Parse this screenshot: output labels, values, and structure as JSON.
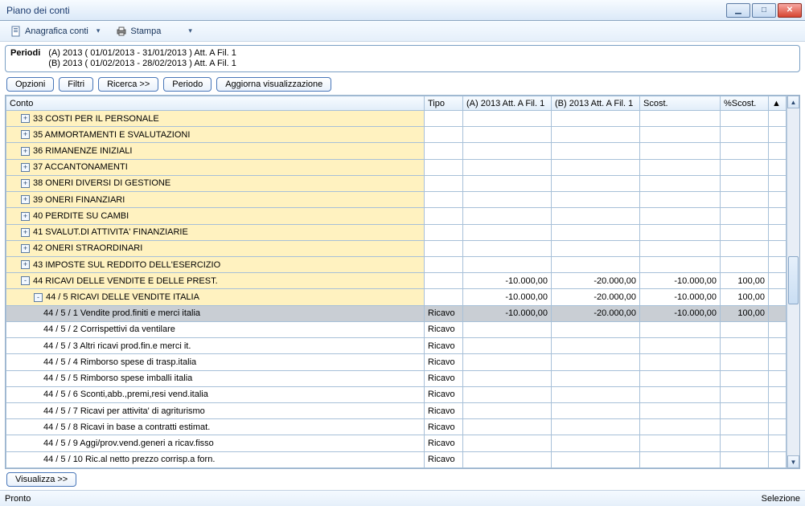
{
  "window": {
    "title": "Piano dei conti"
  },
  "toolbar": {
    "anagrafica": "Anagrafica conti",
    "stampa": "Stampa"
  },
  "period": {
    "label": "Periodi",
    "lineA": "(A) 2013 ( 01/01/2013 - 31/01/2013 )  Att. A Fil. 1",
    "lineB": "(B) 2013 ( 01/02/2013 - 28/02/2013 )  Att. A Fil. 1"
  },
  "buttons": {
    "opzioni": "Opzioni",
    "filtri": "Filtri",
    "ricerca": "Ricerca >>",
    "periodo": "Periodo",
    "aggiorna": "Aggiorna visualizzazione",
    "visualizza": "Visualizza >>"
  },
  "grid": {
    "headers": {
      "conto": "Conto",
      "tipo": "Tipo",
      "a": "(A) 2013 Att. A Fil. 1",
      "b": "(B) 2013 Att. A Fil. 1",
      "scost": "Scost.",
      "pscost": "%Scost."
    },
    "rows": [
      {
        "kind": "cat",
        "exp": "+",
        "indent": 0,
        "conto": "33 COSTI PER IL PERSONALE"
      },
      {
        "kind": "cat",
        "exp": "+",
        "indent": 0,
        "conto": "35 AMMORTAMENTI E SVALUTAZIONI"
      },
      {
        "kind": "cat",
        "exp": "+",
        "indent": 0,
        "conto": "36 RIMANENZE INIZIALI"
      },
      {
        "kind": "cat",
        "exp": "+",
        "indent": 0,
        "conto": "37 ACCANTONAMENTI"
      },
      {
        "kind": "cat",
        "exp": "+",
        "indent": 0,
        "conto": "38 ONERI DIVERSI DI GESTIONE"
      },
      {
        "kind": "cat",
        "exp": "+",
        "indent": 0,
        "conto": "39 ONERI FINANZIARI"
      },
      {
        "kind": "cat",
        "exp": "+",
        "indent": 0,
        "conto": "40 PERDITE SU CAMBI"
      },
      {
        "kind": "cat",
        "exp": "+",
        "indent": 0,
        "conto": "41 SVALUT.DI ATTIVITA' FINANZIARIE"
      },
      {
        "kind": "cat",
        "exp": "+",
        "indent": 0,
        "conto": "42 ONERI STRAORDINARI"
      },
      {
        "kind": "cat",
        "exp": "+",
        "indent": 0,
        "conto": "43 IMPOSTE SUL REDDITO DELL'ESERCIZIO"
      },
      {
        "kind": "cat",
        "exp": "-",
        "indent": 0,
        "conto": "44 RICAVI DELLE VENDITE E DELLE PREST.",
        "a": "-10.000,00",
        "b": "-20.000,00",
        "sc": "-10.000,00",
        "pc": "100,00"
      },
      {
        "kind": "cat",
        "exp": "-",
        "indent": 1,
        "conto": "44 / 5 RICAVI DELLE VENDITE ITALIA",
        "a": "-10.000,00",
        "b": "-20.000,00",
        "sc": "-10.000,00",
        "pc": "100,00"
      },
      {
        "kind": "sel",
        "indent": 2,
        "conto": "44 / 5 / 1 Vendite prod.finiti e merci italia",
        "tipo": "Ricavo",
        "a": "-10.000,00",
        "b": "-20.000,00",
        "sc": "-10.000,00",
        "pc": "100,00"
      },
      {
        "kind": "det",
        "indent": 2,
        "conto": "44 / 5 / 2 Corrispettivi da ventilare",
        "tipo": "Ricavo"
      },
      {
        "kind": "det",
        "indent": 2,
        "conto": "44 / 5 / 3 Altri ricavi prod.fin.e merci it.",
        "tipo": "Ricavo"
      },
      {
        "kind": "det",
        "indent": 2,
        "conto": "44 / 5 / 4 Rimborso spese di trasp.italia",
        "tipo": "Ricavo"
      },
      {
        "kind": "det",
        "indent": 2,
        "conto": "44 / 5 / 5 Rimborso spese imballi italia",
        "tipo": "Ricavo"
      },
      {
        "kind": "det",
        "indent": 2,
        "conto": "44 / 5 / 6 Sconti,abb.,premi,resi vend.italia",
        "tipo": "Ricavo"
      },
      {
        "kind": "det",
        "indent": 2,
        "conto": "44 / 5 / 7 Ricavi per attivita' di agriturismo",
        "tipo": "Ricavo"
      },
      {
        "kind": "det",
        "indent": 2,
        "conto": "44 / 5 / 8 Ricavi in base a contratti estimat.",
        "tipo": "Ricavo"
      },
      {
        "kind": "det",
        "indent": 2,
        "conto": "44 / 5 / 9 Aggi/prov.vend.generi a ricav.fisso",
        "tipo": "Ricavo"
      },
      {
        "kind": "det",
        "indent": 2,
        "conto": "44 / 5 / 10 Ric.al netto prezzo corrisp.a forn.",
        "tipo": "Ricavo"
      }
    ]
  },
  "status": {
    "left": "Pronto",
    "right": "Selezione"
  }
}
